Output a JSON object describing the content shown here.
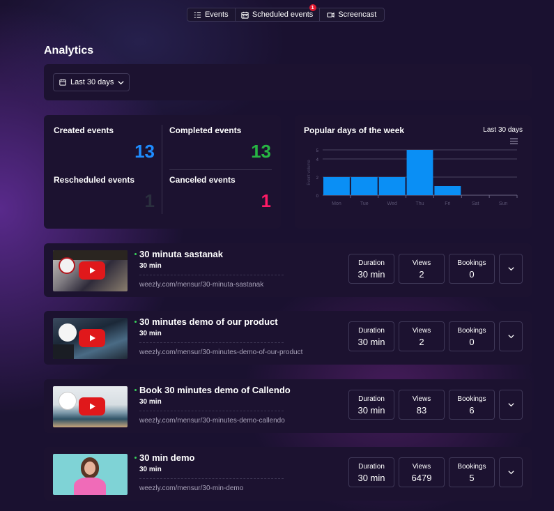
{
  "tabs": [
    {
      "label": "Events",
      "icon": "list-icon"
    },
    {
      "label": "Scheduled events",
      "icon": "calendar-icon",
      "badge": "1"
    },
    {
      "label": "Screencast",
      "icon": "video-icon"
    }
  ],
  "page_title": "Analytics",
  "filter": {
    "selected": "Last 30 days"
  },
  "stats": {
    "created": {
      "label": "Created events",
      "value": "13",
      "color": "#1e8cff"
    },
    "completed": {
      "label": "Completed events",
      "value": "13",
      "color": "#27b543"
    },
    "rescheduled": {
      "label": "Rescheduled events",
      "value": "1",
      "color": "#2a2f3e"
    },
    "canceled": {
      "label": "Canceled events",
      "value": "1",
      "color": "#ff1a66"
    }
  },
  "popular_days": {
    "title": "Popular days of the week",
    "period": "Last 30 days",
    "chart_data": {
      "type": "bar",
      "categories": [
        "Mon",
        "Tue",
        "Wed",
        "Thu",
        "Fri",
        "Sat",
        "Sun"
      ],
      "values": [
        2,
        2,
        2,
        5,
        1,
        0,
        0
      ],
      "ylabel": "Event volume",
      "yticks": [
        "0",
        "2",
        "4",
        "5"
      ],
      "ylim": [
        0,
        5
      ],
      "grid": true,
      "bar_color": "#0a8ff5"
    }
  },
  "events": [
    {
      "title": "30 minuta sastanak",
      "duration": "30 min",
      "url": "weezly.com/mensur/30-minuta-sastanak",
      "metrics": [
        {
          "label": "Duration",
          "value": "30 min"
        },
        {
          "label": "Views",
          "value": "2"
        },
        {
          "label": "Bookings",
          "value": "0"
        }
      ]
    },
    {
      "title": "30 minutes demo of our product",
      "duration": "30 min",
      "url": "weezly.com/mensur/30-minutes-demo-of-our-product",
      "metrics": [
        {
          "label": "Duration",
          "value": "30 min"
        },
        {
          "label": "Views",
          "value": "2"
        },
        {
          "label": "Bookings",
          "value": "0"
        }
      ]
    },
    {
      "title": "Book 30 minutes demo of Callendo",
      "duration": "30 min",
      "url": "weezly.com/mensur/30-minutes-demo-callendo",
      "metrics": [
        {
          "label": "Duration",
          "value": "30 min"
        },
        {
          "label": "Views",
          "value": "83"
        },
        {
          "label": "Bookings",
          "value": "6"
        }
      ]
    },
    {
      "title": "30 min demo",
      "duration": "30 min",
      "url": "weezly.com/mensur/30-min-demo",
      "metrics": [
        {
          "label": "Duration",
          "value": "30 min"
        },
        {
          "label": "Views",
          "value": "6479"
        },
        {
          "label": "Bookings",
          "value": "5"
        }
      ]
    }
  ]
}
